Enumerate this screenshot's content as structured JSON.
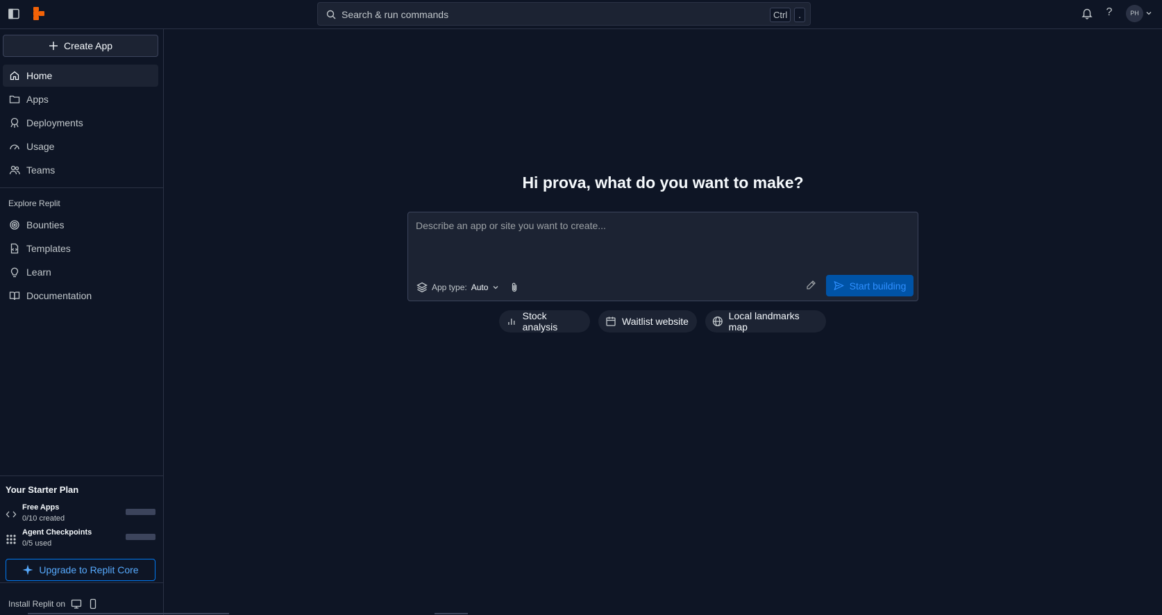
{
  "search": {
    "placeholder": "Search & run commands",
    "kbd_ctrl": "Ctrl",
    "kbd_dot": "."
  },
  "user": {
    "initials": "PH"
  },
  "sidebar": {
    "create_label": "Create App",
    "nav": [
      {
        "label": "Home",
        "icon": "home-icon",
        "active": true
      },
      {
        "label": "Apps",
        "icon": "folder-icon"
      },
      {
        "label": "Deployments",
        "icon": "rocket-icon"
      },
      {
        "label": "Usage",
        "icon": "gauge-icon"
      },
      {
        "label": "Teams",
        "icon": "users-icon"
      }
    ],
    "explore_title": "Explore Replit",
    "explore": [
      {
        "label": "Bounties",
        "icon": "target-icon"
      },
      {
        "label": "Templates",
        "icon": "file-code-icon"
      },
      {
        "label": "Learn",
        "icon": "lightbulb-icon"
      },
      {
        "label": "Documentation",
        "icon": "book-icon"
      }
    ],
    "plan": {
      "title": "Your Starter Plan",
      "items": [
        {
          "name": "Free Apps",
          "sub": "0/10 created",
          "icon": "code-icon",
          "progress": 0
        },
        {
          "name": "Agent Checkpoints",
          "sub": "0/5 used",
          "icon": "grid-dots-icon",
          "progress": 0
        }
      ]
    },
    "upgrade_label": "Upgrade to Replit Core",
    "install_label": "Install Replit on"
  },
  "main": {
    "greeting": "Hi prova, what do you want to make?",
    "prompt_placeholder": "Describe an app or site you want to create...",
    "app_type_label": "App type:",
    "app_type_value": "Auto",
    "start_label": "Start building",
    "chips": [
      {
        "label": "Stock analysis",
        "icon": "bar-chart-icon"
      },
      {
        "label": "Waitlist website",
        "icon": "calendar-icon"
      },
      {
        "label": "Local landmarks map",
        "icon": "globe-icon"
      }
    ]
  },
  "colors": {
    "background": "#0e1525",
    "surface": "#1c2333",
    "border": "#2b3245",
    "accent": "#0079f2",
    "logo": "#f26207"
  }
}
